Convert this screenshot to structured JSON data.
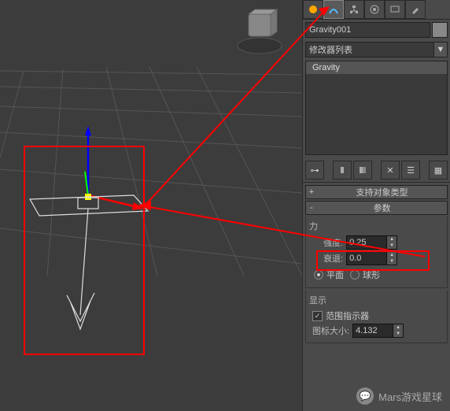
{
  "panel": {
    "object_name": "Gravity001",
    "modifier_list_label": "修改器列表",
    "stack_item": "Gravity",
    "rollup_support": {
      "toggle": "+",
      "title": "支持对象类型"
    },
    "rollup_params": {
      "toggle": "-",
      "title": "参数"
    },
    "force": {
      "group": "力",
      "strength_label": "强度:",
      "strength_value": "0.25",
      "decay_label": "衰退:",
      "decay_value": "0.0",
      "plane_label": "平面",
      "sphere_label": "球形"
    },
    "display": {
      "group": "显示",
      "range_label": "范围指示器",
      "icon_size_label": "图标大小:",
      "icon_size_value": "4.132"
    }
  },
  "watermark": "Mars游戏星球"
}
